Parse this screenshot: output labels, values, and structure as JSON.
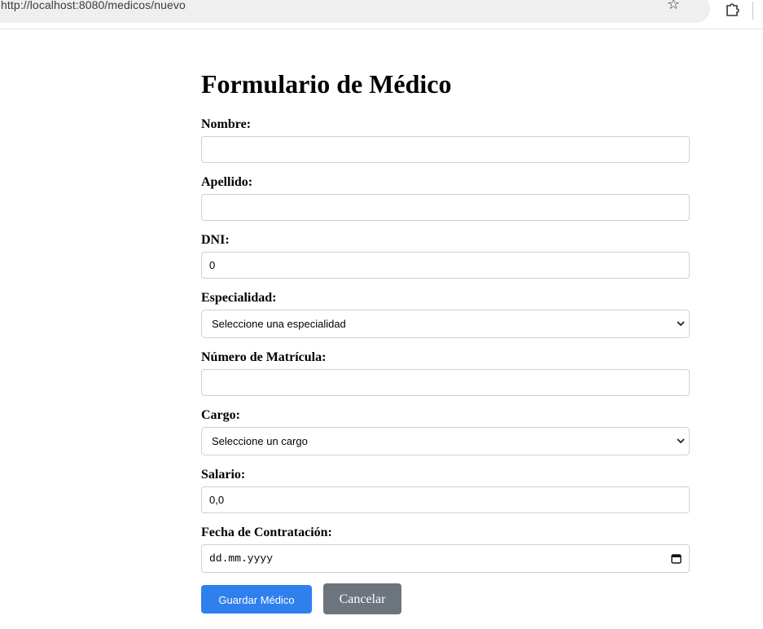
{
  "browser": {
    "url": "http://localhost:8080/medicos/nuevo"
  },
  "form": {
    "title": "Formulario de Médico",
    "fields": {
      "nombre": {
        "label": "Nombre:",
        "value": ""
      },
      "apellido": {
        "label": "Apellido:",
        "value": ""
      },
      "dni": {
        "label": "DNI:",
        "value": "0"
      },
      "especialidad": {
        "label": "Especialidad:",
        "selected": "Seleccione una especialidad"
      },
      "matricula": {
        "label": "Número de Matrícula:",
        "value": ""
      },
      "cargo": {
        "label": "Cargo:",
        "selected": "Seleccione un cargo"
      },
      "salario": {
        "label": "Salario:",
        "value": "0,0"
      },
      "fecha": {
        "label": "Fecha de Contratación:",
        "placeholder": "dd.mm.yyyy"
      }
    },
    "buttons": {
      "save_label": "Guardar Médico",
      "cancel_label": "Cancelar"
    }
  },
  "colors": {
    "primary": "#2f80ed",
    "secondary": "#6c757d"
  }
}
